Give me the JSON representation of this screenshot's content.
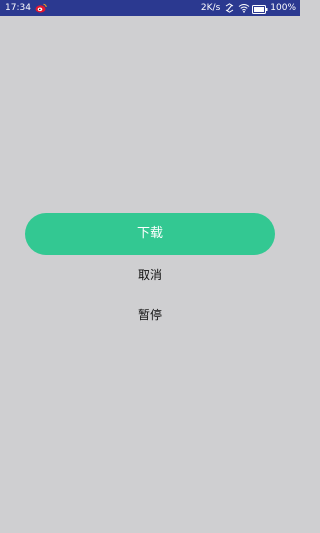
{
  "status_bar": {
    "time": "17:34",
    "network_speed": "2K/s",
    "battery_percent": "100%",
    "icons": [
      "weibo-icon",
      "data-sync-icon",
      "wifi-icon",
      "battery-icon"
    ]
  },
  "actions": {
    "download_label": "下载",
    "cancel_label": "取消",
    "pause_label": "暂停"
  },
  "colors": {
    "status_bar": "#2b3990",
    "background": "#cfcfd1",
    "accent": "#33c892"
  }
}
